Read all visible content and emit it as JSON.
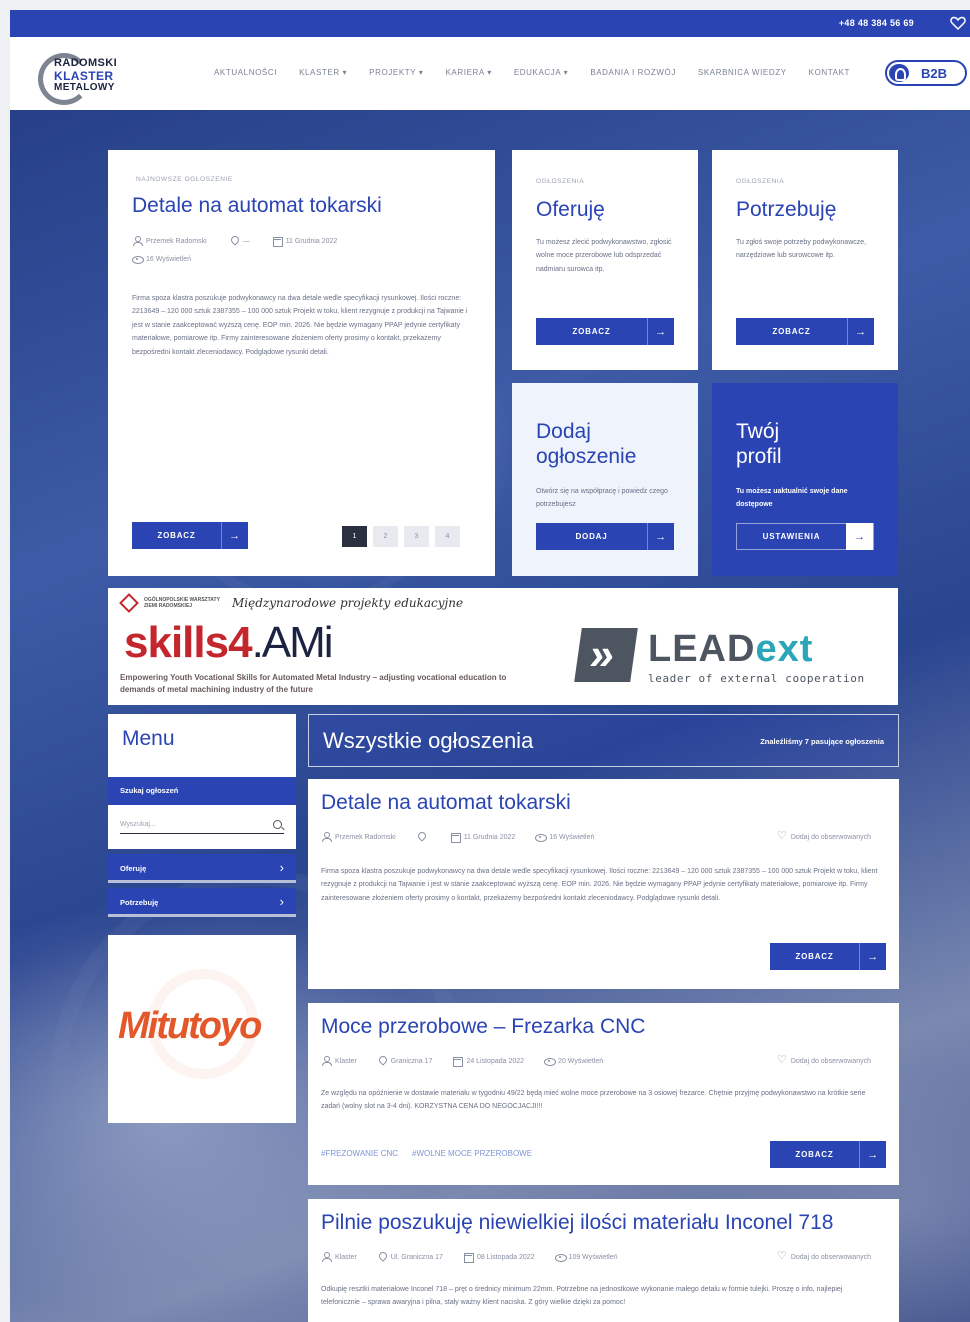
{
  "topbar": {
    "phone": "+48 48 384 56 69"
  },
  "logo": {
    "line1": "RADOMSKI",
    "line2": "KLASTER",
    "line3": "METALOWY"
  },
  "nav": {
    "items": [
      "AKTUALNOŚCI",
      "KLASTER ▾",
      "PROJEKTY ▾",
      "KARIERA ▾",
      "EDUKACJA ▾",
      "BADANIA I ROZWÓJ",
      "SKARBNICA WIEDZY",
      "KONTAKT"
    ],
    "b2b": "B2B"
  },
  "featured": {
    "label": "NAJNOWSZE OGŁOSZENIE",
    "title": "Detale na automat tokarski",
    "author": "Przemek Radomski",
    "location": "—",
    "date": "11 Grudnia 2022",
    "views": "16 Wyświetleń",
    "text": "Firma spoza klastra poszukuje podwykonawcy na dwa detale wedle specyfikacji rysunkowej. Ilości roczne: 2213649 – 120 000 sztuk 2387355 – 100 000 sztuk Projekt w toku, klient rezygnuje z produkcji na Tajwanie i jest w stanie zaakceptować wyższą cenę. EOP min. 2026. Nie będzie wymagany PPAP jedynie certyfikaty materiałowe, pomiarowe itp. Firmy zainteresowane złożeniem oferty prosimy o kontakt, przekażemy bezpośredni kontakt zleceniodawcy. Podglądowe rysunki detali.",
    "button": "ZOBACZ",
    "pages": [
      "1",
      "2",
      "3",
      "4"
    ]
  },
  "offer": {
    "label": "OGŁOSZENIA",
    "title": "Oferuję",
    "text": "Tu możesz zlecić podwykonawstwo, zgłosić wolne moce przerobowe lub odsprzedać nadmiaru surowca itp.",
    "button": "ZOBACZ"
  },
  "need": {
    "label": "OGŁOSZENIA",
    "title": "Potrzebuję",
    "text": "Tu zgłoś swoje potrzeby podwykonawcze, narzędziowe lub surowcowe itp.",
    "button": "ZOBACZ"
  },
  "add": {
    "title1": "Dodaj",
    "title2": "ogłoszenie",
    "text": "Otwórz się na współpracę i powiedz czego potrzebujesz",
    "button": "DODAJ"
  },
  "profile": {
    "title1": "Twój",
    "title2": "profil",
    "text": "Tu możesz uaktualnić swoje dane dostępowe",
    "button": "USTAWIENIA"
  },
  "banner": {
    "org": "OGÓLNOPOLSKIE WARSZTATY ZIEMI RADOMSKIEJ",
    "heading": "Międzynarodowe projekty edukacyjne",
    "skills": "skills",
    "four": "4",
    "ami": ".AMi",
    "desc": "Empowering Youth Vocational Skills for Automated Metal Industry – adjusting vocational education to demands of metal machining industry of the future",
    "lead": "LEAD",
    "ext": "ext",
    "lead_sub": "leader of external cooperation"
  },
  "sidebar": {
    "title": "Menu",
    "search_label": "Szukaj ogłoszeń",
    "search_placeholder": "Wyszukaj...",
    "items": [
      "Oferuję",
      "Potrzebuję"
    ],
    "sponsor": "Mitutoyo"
  },
  "listing": {
    "title": "Wszystkie ogłoszenia",
    "count": "Znaleźliśmy 7 pasujące ogłoszenia",
    "observe": "Dodaj do obserwowanych",
    "items": [
      {
        "title": "Detale na automat tokarski",
        "author": "Przemek Radomski",
        "location": "",
        "date": "11 Grudnia 2022",
        "views": "16 Wyświetleń",
        "text": "Firma spoza klastra poszukuje podwykonawcy na dwa detale wedle specyfikacji rysunkowej. Ilości roczne: 2213649 – 120 000 sztuk 2387355 – 100 000 sztuk Projekt w toku, klient rezygnuje z produkcji na Tajwanie i jest w stanie zaakceptować wyższą cenę. EOP min. 2026. Nie będzie wymagany PPAP jedynie certyfikaty materiałowe, pomiarowe itp. Firmy zainteresowane złożeniem oferty prosimy o kontakt, przekażemy bezpośredni kontakt zleceniodawcy. Podglądowe rysunki detali.",
        "button": "ZOBACZ"
      },
      {
        "title": "Moce przerobowe – Frezarka CNC",
        "author": "Klaster",
        "location": "Graniczna 17",
        "date": "24 Listopada 2022",
        "views": "20 Wyświetleń",
        "text": "Ze względu na opóźnienie w dostawie materiału w tygodniu 49/22 będą mieć wolne moce przerobowe na 3 osiowej frezarce. Chętnie przyjmę podwykonawstwo na krótkie serie zadań (wolny slot na 3-4 dni). KORZYSTNA CENA DO NEGOCJACJI!!!",
        "tags": [
          "#FREZOWANIE CNC",
          "#WOLNE MOCE PRZEROBOWE"
        ],
        "button": "ZOBACZ"
      },
      {
        "title": "Pilnie poszukuję niewielkiej ilości materiału Inconel 718",
        "author": "Klaster",
        "location": "Ul. Graniczna 17",
        "date": "08 Listopada 2022",
        "views": "109 Wyświetleń",
        "text": "Odkupię resztki materiałowe Inconel 718 – pręt o średnicy minimum 22mm. Potrzebne na jednostkowe wykonanie małego detalu w formie tulejki. Proszę o info, najlepiej telefonicznie – sprawa awaryjna i pilna, stały ważny klient naciska. Z góry wielkie dzięki za pomoc!"
      }
    ]
  },
  "colors": {
    "brand": "#2a44b3",
    "accent_red": "#c4262e",
    "mitutoyo": "#e3582a"
  }
}
